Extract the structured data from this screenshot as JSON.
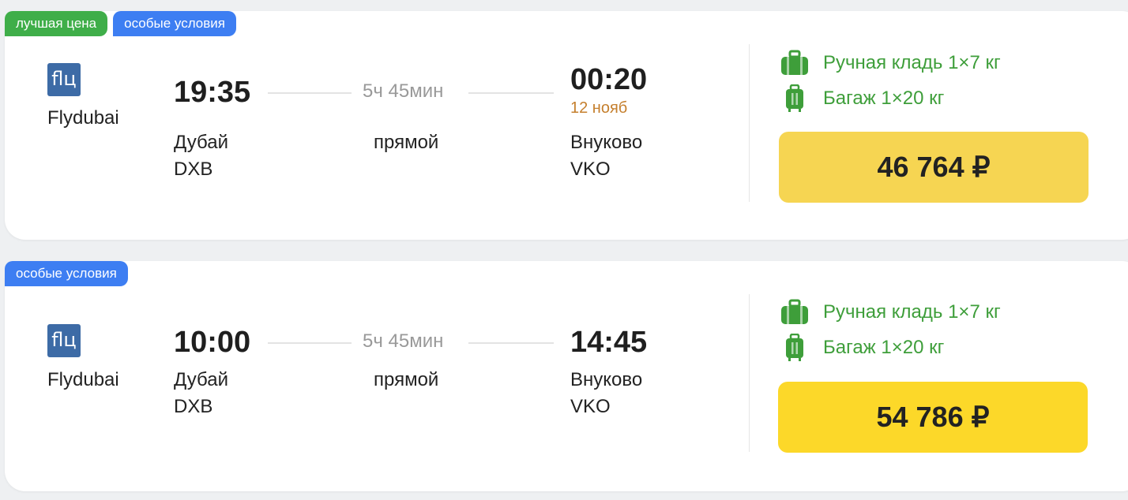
{
  "colors": {
    "badge_best": "#3fae49",
    "badge_special": "#3d7ef2",
    "price_button_1": "#f6d552",
    "price_button_2": "#fcd829",
    "baggage_text": "#3e9e3a",
    "arrival_date": "#c57f2d"
  },
  "flights": [
    {
      "badges": [
        "лучшая цена",
        "особые условия"
      ],
      "airline": {
        "logo_text": "flц",
        "name": "Flydubai"
      },
      "departure": {
        "time": "19:35",
        "city": "Дубай",
        "code": "DXB"
      },
      "duration": "5ч 45мин",
      "stops": "прямой",
      "arrival": {
        "time": "00:20",
        "date": "12 нояб",
        "city": "Внуково",
        "code": "VKO"
      },
      "hand_luggage": {
        "icon": "hand-luggage-icon",
        "text": "Ручная кладь 1×7 кг"
      },
      "baggage": {
        "icon": "suitcase-icon",
        "text": "Багаж 1×20 кг"
      },
      "price": "46 764 ₽"
    },
    {
      "badges": [
        "особые условия"
      ],
      "airline": {
        "logo_text": "flц",
        "name": "Flydubai"
      },
      "departure": {
        "time": "10:00",
        "city": "Дубай",
        "code": "DXB"
      },
      "duration": "5ч 45мин",
      "stops": "прямой",
      "arrival": {
        "time": "14:45",
        "date": "",
        "city": "Внуково",
        "code": "VKO"
      },
      "hand_luggage": {
        "icon": "hand-luggage-icon",
        "text": "Ручная кладь 1×7 кг"
      },
      "baggage": {
        "icon": "suitcase-icon",
        "text": "Багаж 1×20 кг"
      },
      "price": "54 786 ₽"
    }
  ]
}
